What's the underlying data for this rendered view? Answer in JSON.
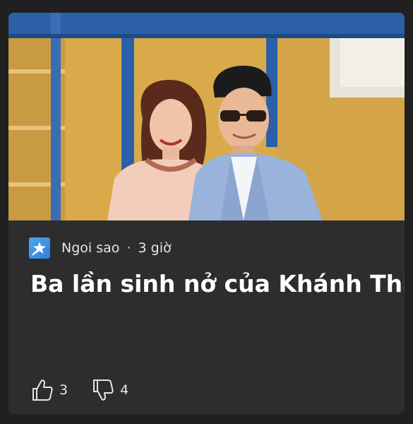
{
  "article": {
    "source": "Ngoi sao",
    "separator": "·",
    "age": "3 giờ",
    "title": "Ba lần sinh nở của Khánh Thi"
  },
  "reactions": {
    "likes": "3",
    "dislikes": "4"
  },
  "hero_image": {
    "subject": "couple-photo"
  },
  "colors": {
    "background": "#202020",
    "card": "#2d2d2d",
    "accent": "#3a9bee",
    "text": "#ffffff"
  }
}
